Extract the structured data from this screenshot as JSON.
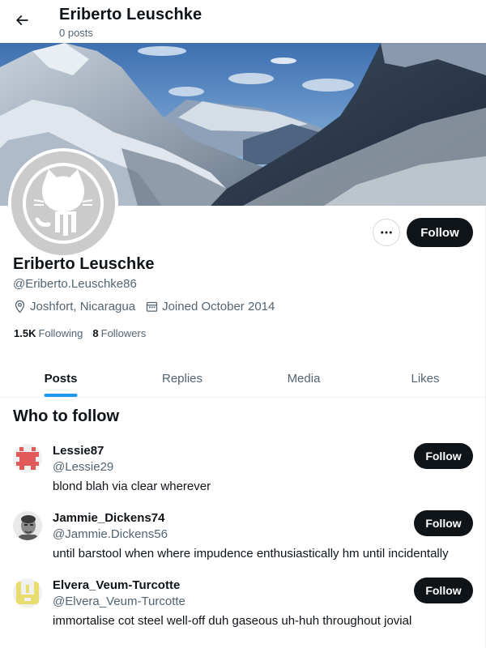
{
  "header": {
    "title": "Eriberto Leuschke",
    "post_count": "0 posts"
  },
  "profile": {
    "name": "Eriberto Leuschke",
    "handle": "@Eriberto.Leuschke86",
    "location": "Joshfort, Nicaragua",
    "joined": "Joined October 2014",
    "following_count": "1.5K",
    "following_label": "Following",
    "followers_count": "8",
    "followers_label": "Followers",
    "follow_label": "Follow",
    "avatar_icon": "github-octocat-icon"
  },
  "tabs": [
    {
      "label": "Posts",
      "active": true
    },
    {
      "label": "Replies",
      "active": false
    },
    {
      "label": "Media",
      "active": false
    },
    {
      "label": "Likes",
      "active": false
    }
  ],
  "who_to_follow": {
    "title": "Who to follow",
    "users": [
      {
        "name": "Lessie87",
        "handle": "@Lessie29",
        "bio": "blond blah via clear wherever",
        "follow_label": "Follow",
        "avatar_icon": "red-identicon"
      },
      {
        "name": "Jammie_Dickens74",
        "handle": "@Jammie.Dickens56",
        "bio": "until barstool when where impudence enthusiastically hm until incidentally",
        "follow_label": "Follow",
        "avatar_icon": "photo-avatar"
      },
      {
        "name": "Elvera_Veum-Turcotte",
        "handle": "@Elvera_Veum-Turcotte",
        "bio": "immortalise cot steel well-off duh gaseous uh-huh throughout jovial",
        "follow_label": "Follow",
        "avatar_icon": "yellow-identicon"
      }
    ]
  },
  "colors": {
    "accent": "#1d9bf0",
    "text": "#0f1419",
    "secondary_text": "#536471",
    "button_dark": "#0f1419"
  }
}
